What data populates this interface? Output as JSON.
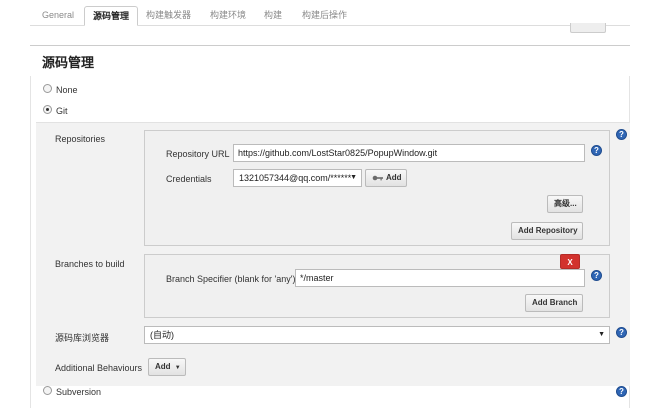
{
  "tabs": [
    {
      "label": "General",
      "active": false
    },
    {
      "label": "源码管理",
      "active": true
    },
    {
      "label": "构建触发器",
      "active": false
    },
    {
      "label": "构建环境",
      "active": false
    },
    {
      "label": "构建",
      "active": false
    },
    {
      "label": "构建后操作",
      "active": false
    }
  ],
  "section": {
    "title": "源码管理"
  },
  "scm_options": {
    "none": "None",
    "git": "Git",
    "subversion": "Subversion",
    "selected": "Git"
  },
  "git": {
    "repositories_label": "Repositories",
    "repository_url_label": "Repository URL",
    "repository_url": "https://github.com/LostStar0825/PopupWindow.git",
    "credentials_label": "Credentials",
    "credentials_value": "1321057344@qq.com/******",
    "add_credentials_label": "Add",
    "advanced_label": "高级...",
    "add_repository_label": "Add Repository",
    "branches_label": "Branches to build",
    "branch_specifier_label": "Branch Specifier (blank for 'any')",
    "branch_specifier": "*/master",
    "delete_branch_label": "X",
    "add_branch_label": "Add Branch",
    "repo_browser_label": "源码库浏览器",
    "repo_browser_value": "(自动)",
    "additional_behaviours_label": "Additional Behaviours",
    "add_behaviour_label": "Add"
  },
  "help_glyph": "?",
  "icons": {
    "help": "help-icon",
    "credentials_key": "key-icon",
    "dropdown": "caret-down-icon"
  }
}
